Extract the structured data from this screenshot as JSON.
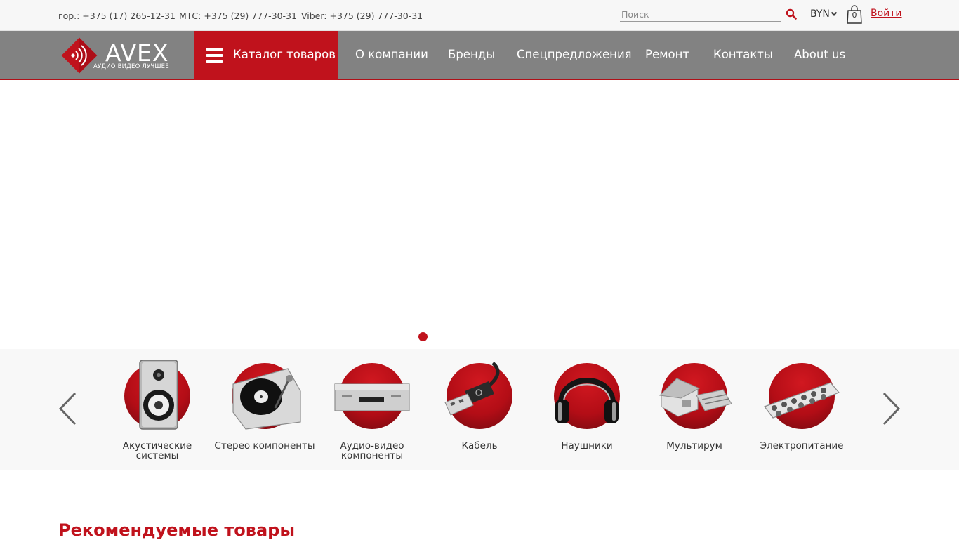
{
  "topbar": {
    "phone_city": "гор.: +375 (17) 265-12-31",
    "phone_mts": "МТС: +375 (29) 777-30-31",
    "phone_viber": "Viber: +375 (29) 777-30-31",
    "search_placeholder": "Поиск",
    "currency": "BYN",
    "cart_count": "0",
    "login": "Войти"
  },
  "logo": {
    "name": "AVEX",
    "tagline": "АУДИО ВИДЕО ЛУЧШЕЕ"
  },
  "nav": {
    "catalog": "Каталог товаров",
    "items": [
      "О компании",
      "Бренды",
      "Спецпредложения",
      "Ремонт",
      "Контакты",
      "About us"
    ]
  },
  "categories": [
    {
      "name": "Акустические системы",
      "icon": "speaker-icon"
    },
    {
      "name": "Стерео компоненты",
      "icon": "turntable-icon"
    },
    {
      "name": "Аудио-видео компоненты",
      "icon": "av-receiver-icon"
    },
    {
      "name": "Кабель",
      "icon": "usb-cable-icon"
    },
    {
      "name": "Наушники",
      "icon": "headphones-icon"
    },
    {
      "name": "Мультирум",
      "icon": "multiroom-house-icon"
    },
    {
      "name": "Электропитание",
      "icon": "power-strip-icon"
    }
  ],
  "colors": {
    "accent": "#c0121c",
    "nav_bg": "#828282",
    "topbar_bg": "#f7f7f7",
    "band_bg": "#f8f8f8"
  },
  "recommended_title": "Рекомендуемые товары"
}
